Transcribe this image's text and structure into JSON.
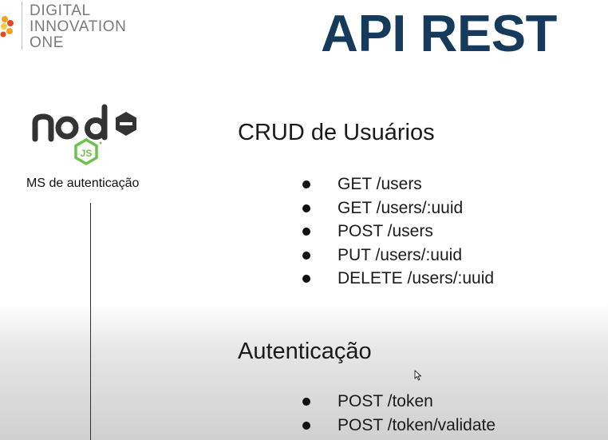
{
  "brand": {
    "logo_lines": [
      "DIGITAL",
      "INNOVATION",
      "ONE"
    ]
  },
  "slide": {
    "title": "API REST",
    "service_label": "MS de autenticação",
    "node_logo_icon": "nodejs-logo-icon",
    "sections": [
      {
        "title": "CRUD de Usuários",
        "endpoints": [
          "GET /users",
          "GET /users/:uuid",
          "POST /users",
          "PUT /users/:uuid",
          "DELETE /users/:uuid"
        ]
      },
      {
        "title": "Autenticação",
        "endpoints": [
          "POST /token",
          "POST /token/validate"
        ]
      }
    ]
  },
  "colors": {
    "title": "#153a5c",
    "node_dark": "#333333",
    "node_green": "#6cc24a",
    "brand_orange": "#f4a321",
    "brand_red": "#e6452b"
  }
}
